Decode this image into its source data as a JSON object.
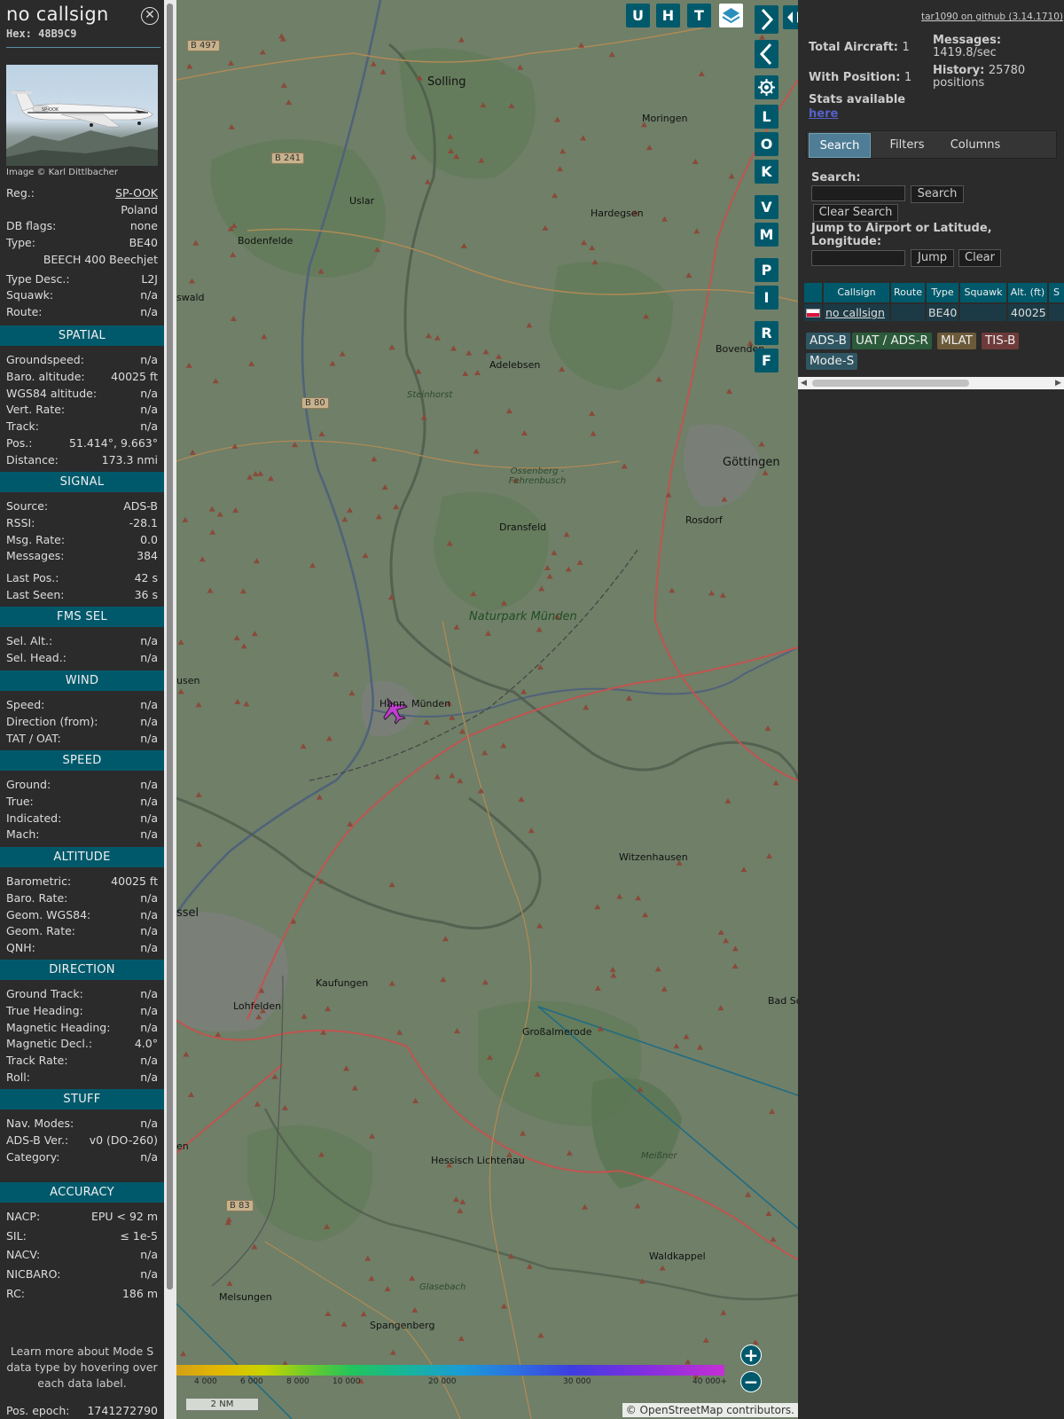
{
  "aircraft": {
    "callsign": "no callsign",
    "hex": "Hex:  48B9C9",
    "image_credit": "Image © Karl Dittlbacher"
  },
  "details": [
    {
      "k": "Reg.:",
      "v": "SP-OOK",
      "link": true
    },
    {
      "k": "",
      "v": "Poland"
    },
    {
      "k": "DB flags:",
      "v": "none"
    },
    {
      "k": "Type:",
      "v": "BE40"
    },
    {
      "k": "",
      "v": "BEECH 400 Beechjet"
    },
    {
      "k": "Type Desc.:",
      "v": "L2J"
    },
    {
      "k": "Squawk:",
      "v": "n/a"
    },
    {
      "k": "Route:",
      "v": "n/a"
    }
  ],
  "sections": [
    {
      "title": "SPATIAL",
      "rows": [
        {
          "k": "Groundspeed:",
          "v": "n/a"
        },
        {
          "k": "Baro. altitude:",
          "v": "40025 ft"
        },
        {
          "k": "WGS84 altitude:",
          "v": "n/a"
        },
        {
          "k": "Vert. Rate:",
          "v": "n/a"
        },
        {
          "k": "Track:",
          "v": "n/a"
        },
        {
          "k": "Pos.:",
          "v": "51.414°, 9.663°"
        },
        {
          "k": "Distance:",
          "v": "173.3 nmi"
        }
      ]
    },
    {
      "title": "SIGNAL",
      "rows": [
        {
          "k": "Source:",
          "v": "ADS-B"
        },
        {
          "k": "RSSI:",
          "v": "-28.1"
        },
        {
          "k": "Msg. Rate:",
          "v": "0.0"
        },
        {
          "k": "Messages:",
          "v": "384"
        },
        {
          "k": "Last Pos.:",
          "v": "42 s"
        },
        {
          "k": "Last Seen:",
          "v": "36 s"
        }
      ]
    },
    {
      "title": "FMS SEL",
      "rows": [
        {
          "k": "Sel. Alt.:",
          "v": "n/a"
        },
        {
          "k": "Sel. Head.:",
          "v": "n/a"
        }
      ]
    },
    {
      "title": "WIND",
      "rows": [
        {
          "k": "Speed:",
          "v": "n/a"
        },
        {
          "k": "Direction (from):",
          "v": "n/a"
        },
        {
          "k": "TAT / OAT:",
          "v": "n/a"
        }
      ]
    },
    {
      "title": "SPEED",
      "rows": [
        {
          "k": "Ground:",
          "v": "n/a"
        },
        {
          "k": "True:",
          "v": "n/a"
        },
        {
          "k": "Indicated:",
          "v": "n/a"
        },
        {
          "k": "Mach:",
          "v": "n/a"
        }
      ]
    },
    {
      "title": "ALTITUDE",
      "rows": [
        {
          "k": "Barometric:",
          "v": "40025 ft"
        },
        {
          "k": "Baro. Rate:",
          "v": "n/a"
        },
        {
          "k": "Geom. WGS84:",
          "v": "n/a"
        },
        {
          "k": "Geom. Rate:",
          "v": "n/a"
        },
        {
          "k": "QNH:",
          "v": "n/a"
        }
      ]
    },
    {
      "title": "DIRECTION",
      "rows": [
        {
          "k": "Ground Track:",
          "v": "n/a"
        },
        {
          "k": "True Heading:",
          "v": "n/a"
        },
        {
          "k": "Magnetic Heading:",
          "v": "n/a"
        },
        {
          "k": "Magnetic Decl.:",
          "v": "4.0°"
        },
        {
          "k": "Track Rate:",
          "v": "n/a"
        },
        {
          "k": "Roll:",
          "v": "n/a"
        }
      ]
    },
    {
      "title": "STUFF",
      "rows": [
        {
          "k": "Nav. Modes:",
          "v": "n/a"
        },
        {
          "k": "ADS-B Ver.:",
          "v": "v0 (DO-260)"
        },
        {
          "k": "Category:",
          "v": "n/a"
        }
      ]
    },
    {
      "title": "ACCURACY",
      "rows": [
        {
          "k": "NACP:",
          "v": "EPU < 92 m"
        },
        {
          "k": "SIL:",
          "v": "≤ 1e-5"
        },
        {
          "k": "NACV:",
          "v": "n/a"
        },
        {
          "k": "NICBARO:",
          "v": "n/a"
        },
        {
          "k": "RC:",
          "v": "186 m"
        }
      ]
    }
  ],
  "learn_more": "Learn more about Mode S data type by hovering over each data label.",
  "pos_epoch": {
    "k": "Pos. epoch:",
    "v": "1741272790"
  },
  "map": {
    "top_buttons": [
      "U",
      "H",
      "T"
    ],
    "side_buttons": [
      "L",
      "O",
      "K",
      "V",
      "M",
      "P",
      "I",
      "R",
      "F"
    ],
    "places": [
      {
        "t": "Solling",
        "cls": "big"
      },
      {
        "t": "Uslar"
      },
      {
        "t": "Moringen"
      },
      {
        "t": "Bodenfelde"
      },
      {
        "t": "Hardegsen"
      },
      {
        "t": "Adelebsen"
      },
      {
        "t": "Bovenden"
      },
      {
        "t": "Göttingen",
        "cls": "big"
      },
      {
        "t": "Rosdorf"
      },
      {
        "t": "Dransfeld"
      },
      {
        "t": "Hann. Münden"
      },
      {
        "t": "Witzenhausen"
      },
      {
        "t": "Kaufungen"
      },
      {
        "t": "Lohfelden"
      },
      {
        "t": "Großalmerode"
      },
      {
        "t": "Hessisch Lichtenau"
      },
      {
        "t": "Waldkappel"
      },
      {
        "t": "Melsungen"
      },
      {
        "t": "Spangenberg"
      },
      {
        "t": "Bad So… Allen…"
      },
      {
        "t": "Steinhorst",
        "cls": "ital"
      },
      {
        "t": "Glasebach",
        "cls": "ital"
      },
      {
        "t": "Meißner",
        "cls": "ital"
      },
      {
        "t": "swald"
      },
      {
        "t": "usen"
      },
      {
        "t": "ssel",
        "cls": "big"
      },
      {
        "t": "en"
      }
    ],
    "park": "Naturpark Münden",
    "park2": "Ossenberg - Fehrenbusch",
    "road_labels": [
      "B 497",
      "B 241",
      "B 80",
      "B 83"
    ],
    "alt_scale": [
      "4 000",
      "6 000",
      "8 000",
      "10 000",
      "20 000",
      "30 000",
      "40 000+"
    ],
    "scale": "2 NM",
    "attribution": "© OpenStreetMap contributors."
  },
  "stats": {
    "github": "tar1090 on github (3.14.1710)",
    "total_label": "Total Aircraft:",
    "total": "1",
    "with_pos_label": "With Position:",
    "with_pos": "1",
    "messages_label": "Messages:",
    "messages": "1419.8/sec",
    "history_label": "History:",
    "history": "25780 positions",
    "stats_avail": "Stats available",
    "here": "here"
  },
  "tabs": [
    "Search",
    "Filters",
    "Columns"
  ],
  "search": {
    "label": "Search:",
    "btn": "Search",
    "clear": "Clear Search",
    "jump_label": "Jump to Airport or Latitude, Longitude:",
    "jump_btn": "Jump",
    "clear_btn": "Clear"
  },
  "table": {
    "headers": [
      "",
      "Callsign",
      "Route",
      "Type",
      "Squawk",
      "Alt. (ft)",
      "S"
    ],
    "row": [
      "",
      "no callsign",
      "",
      "BE40",
      "",
      "40025",
      ""
    ]
  },
  "badges": [
    {
      "t": "ADS-B",
      "bg": "#2f5562",
      "fg": "#eee"
    },
    {
      "t": "UAT / ADS-R",
      "bg": "#2c5a3a",
      "fg": "#eee"
    },
    {
      "t": "MLAT",
      "bg": "#6b5a3a",
      "fg": "#eee"
    },
    {
      "t": "TIS-B",
      "bg": "#6e3a3a",
      "fg": "#eee"
    },
    {
      "t": "Mode-S",
      "bg": "#2f5562",
      "fg": "#eee"
    }
  ]
}
